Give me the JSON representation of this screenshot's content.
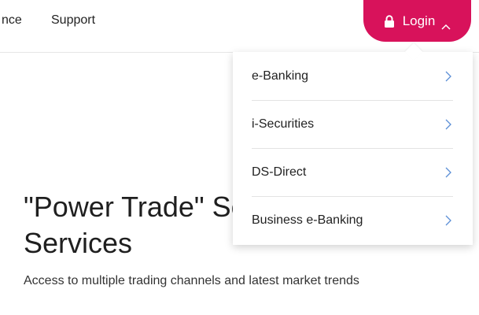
{
  "nav": {
    "cut_label": "nce",
    "support_label": "Support",
    "login_label": "Login",
    "lock_icon": "lock-icon",
    "chevron_icon": "chevron-up-icon",
    "accent_color": "#d8125b"
  },
  "dropdown": {
    "items": [
      {
        "label": "e-Banking"
      },
      {
        "label": "i-Securities"
      },
      {
        "label": "DS-Direct"
      },
      {
        "label": "Business e-Banking"
      }
    ],
    "chevron_icon": "chevron-right-icon",
    "chevron_color": "#5b8fd6"
  },
  "hero": {
    "title": "\"Power Trade\" Securities Services",
    "subtitle": "Access to multiple trading channels and latest market trends"
  }
}
